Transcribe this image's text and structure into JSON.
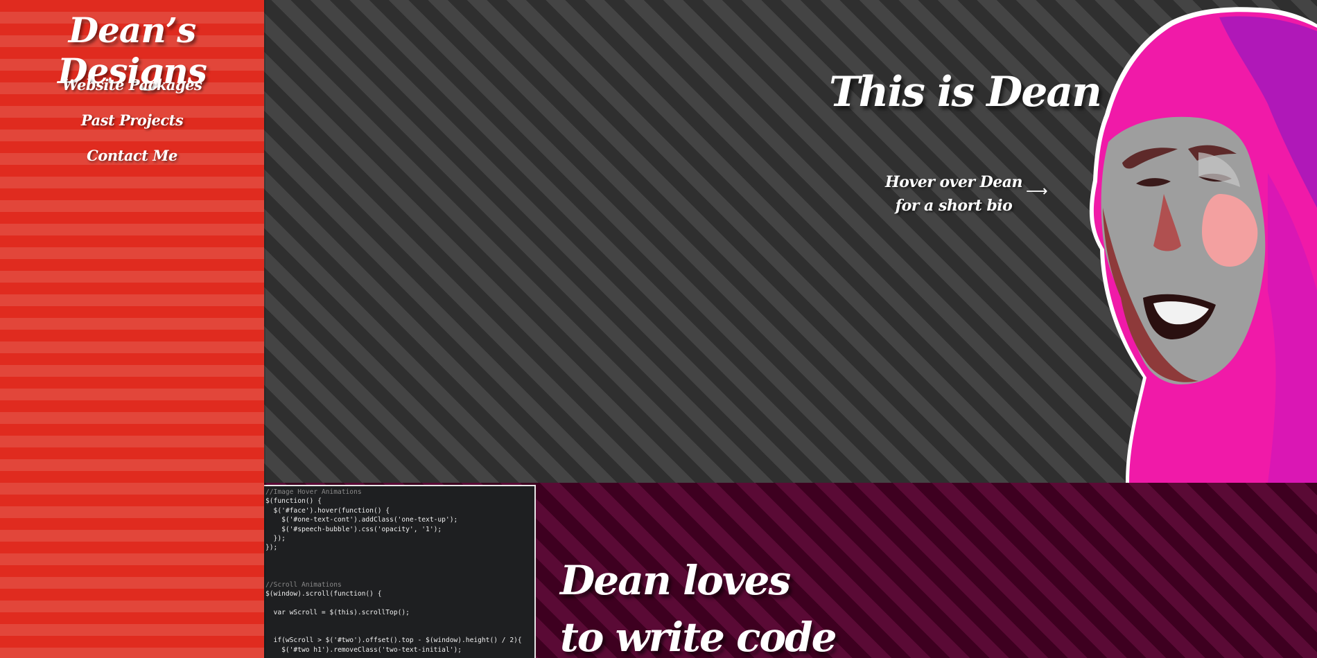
{
  "sidebar": {
    "brand": "Dean’s Designs",
    "nav": [
      {
        "label": "Website Packages"
      },
      {
        "label": "Past Projects"
      },
      {
        "label": "Contact Me"
      }
    ],
    "colors": {
      "stripe_a": "#e02b1f",
      "stripe_b": "#e2463a"
    }
  },
  "hero": {
    "title": "This is Dean",
    "hint_line1": "Hover over Dean",
    "hint_line2": "for a short bio",
    "arrow": "⟶",
    "photo_icon": "dean-face-illustration"
  },
  "code_section": {
    "title_line1": "Dean loves",
    "title_line2": "to write code",
    "code_lines": [
      "//Image Hover Animations",
      "$(function() {",
      "  $('#face').hover(function() {",
      "    $('#one-text-cont').addClass('one-text-up');",
      "    $('#speech-bubble').css('opacity', '1');",
      "  });",
      "});",
      "",
      "",
      "",
      "//Scroll Animations",
      "$(window).scroll(function() {",
      "",
      "  var wScroll = $(this).scrollTop();",
      "",
      "",
      "  if(wScroll > $('#two').offset().top - $(window).height() / 2){",
      "    $('#two h1').removeClass('two-text-initial');"
    ]
  }
}
